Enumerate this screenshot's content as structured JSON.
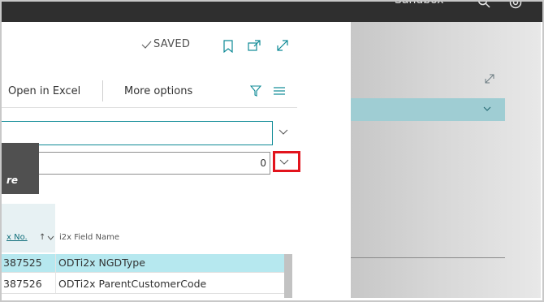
{
  "topbar": {
    "environment": "Sandbox",
    "search_icon": "search-icon",
    "settings_icon": "settings-icon"
  },
  "panel": {
    "saved_label": "SAVED",
    "icons": [
      "checkmark-icon",
      "bookmark-icon",
      "open-new-window-icon",
      "expand-icon"
    ]
  },
  "action_bar": {
    "open_in_excel": "Open in Excel",
    "more_options": "More options",
    "icons": [
      "filter-icon",
      "list-view-icon"
    ]
  },
  "form": {
    "field1_value": "",
    "field2_value": "0"
  },
  "tooltip": {
    "text": "re"
  },
  "table": {
    "columns": [
      "x No.",
      "i2x Field Name"
    ],
    "sort_indicator": "↑",
    "rows": [
      {
        "no": "387525",
        "field_name": "ODTi2x NGDType"
      },
      {
        "no": "387526",
        "field_name": "ODTi2x ParentCustomerCode"
      }
    ]
  },
  "colors": {
    "accent": "#0e8a96",
    "selected_row": "#b6e8ef",
    "highlight_box": "#e2141d",
    "topbar": "#2f2f2f"
  }
}
